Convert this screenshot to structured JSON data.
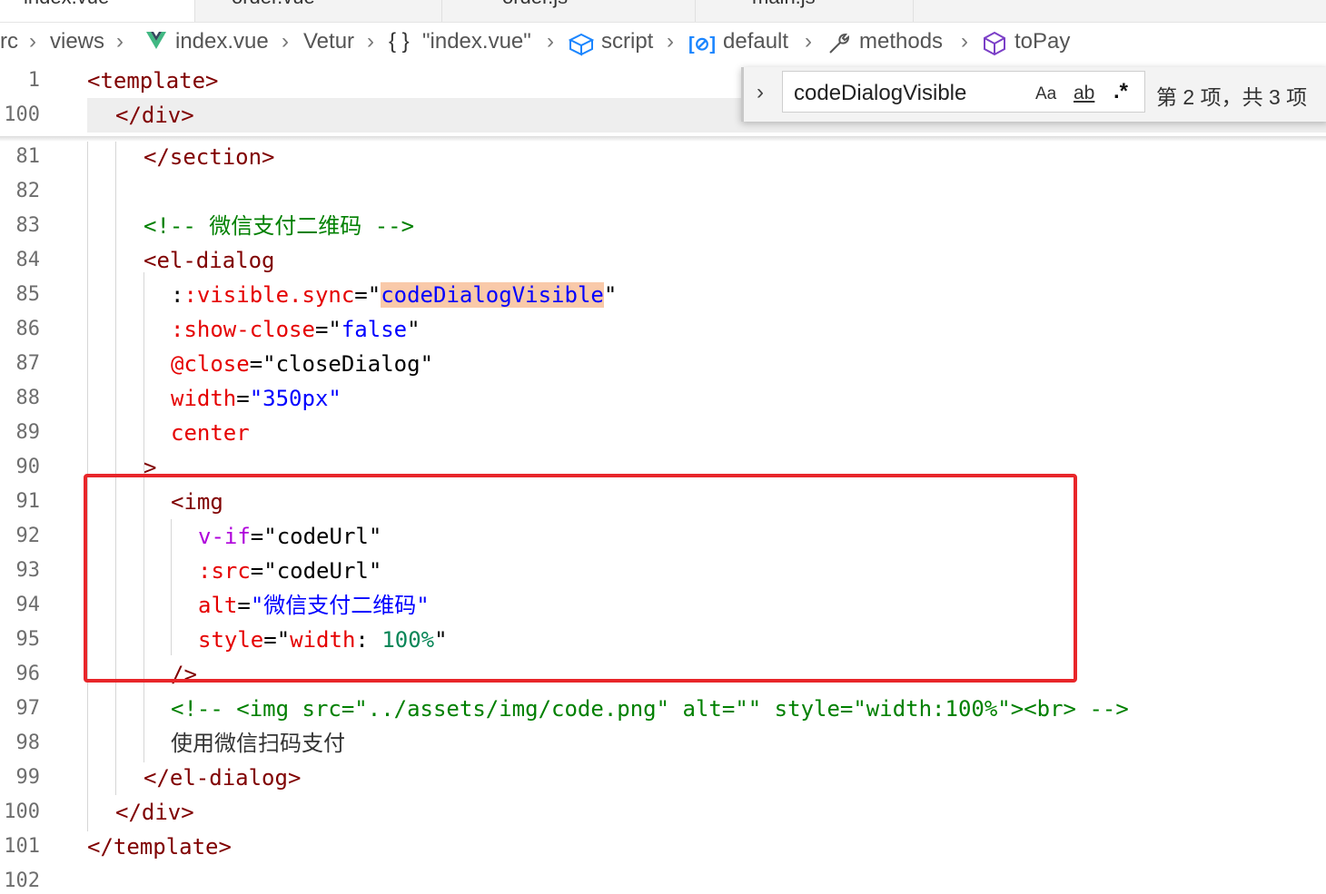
{
  "tabs": [
    {
      "label": "index.vue"
    },
    {
      "label": "order.vue"
    },
    {
      "label": "order.js"
    },
    {
      "label": "main.js"
    }
  ],
  "breadcrumb": {
    "items": [
      {
        "label": "src",
        "icon": ""
      },
      {
        "label": "views",
        "icon": ""
      },
      {
        "label": "index.vue",
        "icon": "vue-icon"
      },
      {
        "label": "Vetur",
        "icon": ""
      },
      {
        "label": "\"index.vue\"",
        "icon": "braces-icon"
      },
      {
        "label": "script",
        "icon": "cube-icon"
      },
      {
        "label": "default",
        "icon": "bracket-icon"
      },
      {
        "label": "methods",
        "icon": "wrench-icon"
      },
      {
        "label": "toPay",
        "icon": "cube-icon"
      }
    ]
  },
  "find": {
    "query": "codeDialogVisible",
    "match_case": "Aa",
    "whole_word": "ab",
    "regex": ".*",
    "result": "第 2 项，共 3 项"
  },
  "sticky": {
    "lines": [
      {
        "num": "1",
        "text": "<template>"
      },
      {
        "num": "100",
        "text": "</div>"
      }
    ]
  },
  "code": {
    "line_numbers": [
      "81",
      "82",
      "83",
      "84",
      "85",
      "86",
      "87",
      "88",
      "89",
      "90",
      "91",
      "92",
      "93",
      "94",
      "95",
      "96",
      "97",
      "98",
      "99",
      "100",
      "101",
      "102"
    ],
    "l81": "</section>",
    "l83": "<!-- 微信支付二维码 -->",
    "l84": "<el-dialog",
    "l85_attr": ":visible.sync",
    "l85_val": "codeDialogVisible",
    "l86_attr": ":show-close",
    "l86_val": "false",
    "l87_attr": "@close",
    "l87_val": "closeDialog",
    "l88_attr": "width",
    "l88_val": "\"350px\"",
    "l89": "center",
    "l90": ">",
    "l91": "<img",
    "l92_attr": "v-if",
    "l92_val": "codeUrl",
    "l93_attr": ":src",
    "l93_val": "codeUrl",
    "l94_attr": "alt",
    "l94_val": "\"微信支付二维码\"",
    "l95_attr": "style",
    "l95_prop": "width",
    "l95_num": "100%",
    "l96": "/>",
    "l97": "<!-- <img src=\"../assets/img/code.png\" alt=\"\" style=\"width:100%\"><br> -->",
    "l98": "使用微信扫码支付",
    "l99": "</el-dialog>",
    "l100": "</div>",
    "l101": "</template>"
  }
}
